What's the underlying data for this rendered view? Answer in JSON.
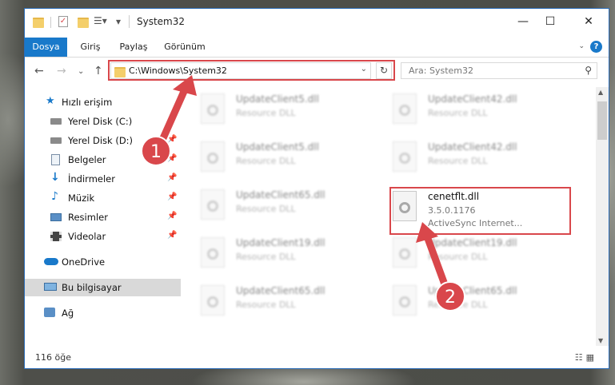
{
  "window": {
    "title": "System32",
    "controls": {
      "minimize": "—",
      "maximize": "☐",
      "close": "✕"
    }
  },
  "ribbon": {
    "tabs": [
      "Dosya",
      "Giriş",
      "Paylaş",
      "Görünüm"
    ],
    "help": "?"
  },
  "address_bar": {
    "path": "C:\\Windows\\System32",
    "search_placeholder": "Ara: System32"
  },
  "nav_pane": {
    "items": [
      {
        "label": "Hızlı erişim",
        "icon": "star-icon"
      },
      {
        "label": "Yerel Disk (C:)",
        "icon": "drive-icon"
      },
      {
        "label": "Yerel Disk (D:)",
        "icon": "drive-icon"
      },
      {
        "label": "Belgeler",
        "icon": "documents-icon"
      },
      {
        "label": "İndirmeler",
        "icon": "download-icon"
      },
      {
        "label": "Müzik",
        "icon": "music-icon"
      },
      {
        "label": "Resimler",
        "icon": "pictures-icon"
      },
      {
        "label": "Videolar",
        "icon": "videos-icon"
      },
      {
        "label": "OneDrive",
        "icon": "cloud-icon"
      },
      {
        "label": "Bu bilgisayar",
        "icon": "computer-icon"
      },
      {
        "label": "Ağ",
        "icon": "network-icon"
      }
    ]
  },
  "files": {
    "left": [
      {
        "name": "UpdateClient5.dll",
        "desc": "Resource DLL"
      },
      {
        "name": "UpdateClient5.dll",
        "desc": "Resource DLL"
      },
      {
        "name": "UpdateClient65.dll",
        "desc": "Resource DLL"
      },
      {
        "name": "UpdateClient19.dll",
        "desc": "Resource DLL"
      },
      {
        "name": "UpdateClient65.dll",
        "desc": "Resource DLL"
      }
    ],
    "right": [
      {
        "name": "UpdateClient42.dll",
        "desc": "Resource DLL"
      },
      {
        "name": "UpdateClient42.dll",
        "desc": "Resource DLL"
      },
      {
        "name": "UpdateClient19.dll",
        "desc": "Resource DLL"
      },
      {
        "name": "UpdateClient65.dll",
        "desc": "Resource DLL"
      }
    ],
    "highlighted": {
      "name": "cenetflt.dll",
      "version": "3.5.0.1176",
      "desc": "ActiveSync Internet..."
    }
  },
  "status": {
    "count": "116 öğe"
  },
  "annotations": {
    "badge1": "1",
    "badge2": "2",
    "color": "#d9474b"
  }
}
